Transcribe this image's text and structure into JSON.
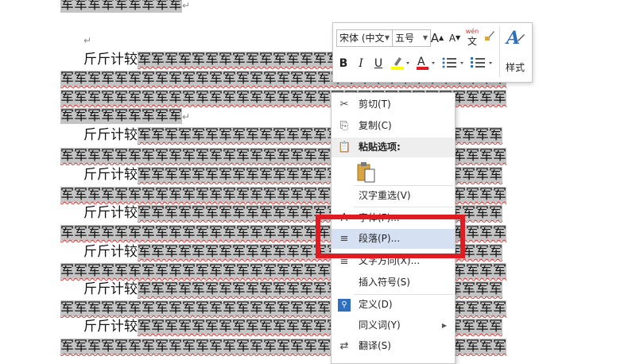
{
  "document": {
    "lines": [
      {
        "segments": [
          {
            "text": "军军军军军军军军军",
            "hl": true
          },
          {
            "text": "↵",
            "mark": true
          }
        ]
      },
      {
        "segments": [
          {
            "text": "↵",
            "mark": true
          }
        ],
        "indent": 105
      },
      {
        "segments": [
          {
            "text": "斤斤计较",
            "hl": false
          },
          {
            "text": "军军军军军军军军军军军军军军军军军军军军军军军军军军军",
            "hl": true,
            "wavy": true
          }
        ],
        "indent": 105
      },
      {
        "segments": [
          {
            "text": "军军军军军军军军军军军军军军军军军军军军军军军军军军军军军军军军军",
            "hl": true,
            "wavy": true
          }
        ]
      },
      {
        "segments": [
          {
            "text": "军军军军军军军军军军军军军军军军军军军军军军军军军军军军军军军军军",
            "hl": true,
            "wavy": true
          }
        ]
      },
      {
        "segments": [
          {
            "text": "军军军军军军军军军",
            "hl": true
          },
          {
            "text": "↵",
            "mark": true
          }
        ]
      },
      {
        "segments": [
          {
            "text": "斤斤计较",
            "hl": false
          },
          {
            "text": "军军军军军军军军军军军军军军军军军军军军军军军军军军军",
            "hl": true,
            "wavy": true
          }
        ],
        "indent": 105
      },
      {
        "segments": [
          {
            "text": "军军军军军军军军军军军军军军军军军军军军军军军军军军军军军军军军军",
            "hl": true,
            "wavy": true
          }
        ]
      },
      {
        "segments": [
          {
            "text": "斤斤计较",
            "hl": false
          },
          {
            "text": "军军军军军军军军军军军军军军军军军军军军军军军军军军军",
            "hl": true,
            "wavy": true
          }
        ],
        "indent": 105
      },
      {
        "segments": [
          {
            "text": "军军军军军军军军军军军军军军军军军军军军军军军军军军军军军军军军军",
            "hl": true,
            "wavy": true
          }
        ]
      },
      {
        "segments": [
          {
            "text": "斤斤计较",
            "hl": false
          },
          {
            "text": "军军军军军军军军军军军军军军军军军军军军军军军军军军军",
            "hl": true,
            "wavy": true
          }
        ],
        "indent": 105
      },
      {
        "segments": [
          {
            "text": "军军军军军军军军军军军军军军军军军军军军军军军军军军军军军军军军军",
            "hl": true,
            "wavy": true
          }
        ]
      },
      {
        "segments": [
          {
            "text": "斤斤计较",
            "hl": false
          },
          {
            "text": "军军军军军军军军军军军军军军军军军军军军军军军军军军军",
            "hl": true,
            "wavy": true
          }
        ],
        "indent": 105
      },
      {
        "segments": [
          {
            "text": "军军军军军军军军军军军军军军军军军军军军军军军军军军军军军军军军军",
            "hl": true,
            "wavy": true
          }
        ]
      },
      {
        "segments": [
          {
            "text": "斤斤计较",
            "hl": false
          },
          {
            "text": "军军军军军军军军军军军军军军军军军军军军军军军军军军军",
            "hl": true,
            "wavy": true
          }
        ],
        "indent": 105
      },
      {
        "segments": [
          {
            "text": "军军军军军军军军军军军军军军军军军军军军军军军军军军军军军军军军军",
            "hl": true,
            "wavy": true
          }
        ]
      },
      {
        "segments": [
          {
            "text": "斤斤计较",
            "hl": false
          },
          {
            "text": "军军军军军军军军军军军军军军军军军军军军军军军军军军军",
            "hl": true,
            "wavy": true
          }
        ],
        "indent": 105
      },
      {
        "segments": [
          {
            "text": "军军军军军军军军军军军军军军军军军军军军军军军军军军军军军军军军军",
            "hl": true,
            "wavy": true
          }
        ]
      }
    ]
  },
  "mini_toolbar": {
    "font_name": "宋体 (中文",
    "font_size": "五号",
    "grow_font": "A",
    "shrink_font": "A",
    "phonetic": "wén",
    "phonetic_char": "文",
    "bold": "B",
    "italic": "I",
    "underline": "U",
    "font_color": "A",
    "styles_label": "样式",
    "font_color_hex": "#e11b22",
    "highlight_hex": "#ffff00"
  },
  "context_menu": {
    "items": [
      {
        "icon": "✂",
        "label": "剪切(T)"
      },
      {
        "icon": "⎘",
        "label": "复制(C)"
      },
      {
        "icon": "📋",
        "label": "粘贴选项:"
      },
      {
        "icon": "",
        "label": ""
      },
      {
        "icon": "",
        "label": "汉字重选(V)"
      },
      {
        "icon": "A",
        "label": "字体(F)..."
      },
      {
        "icon": "≡",
        "label": "段落(P)..."
      },
      {
        "icon": "≣",
        "label": "文字方向(X)..."
      },
      {
        "icon": "",
        "label": "插入符号(S)"
      },
      {
        "icon": "🔍",
        "label": "定义(D)"
      },
      {
        "icon": "",
        "label": "同义词(Y)"
      },
      {
        "icon": "⇄",
        "label": "翻译(S)"
      }
    ],
    "submenu_arrow": "▶"
  },
  "colors": {
    "selection": "#c4c4c4",
    "menu_hover": "#d5e1f2",
    "annotation_red": "#e11b22"
  }
}
